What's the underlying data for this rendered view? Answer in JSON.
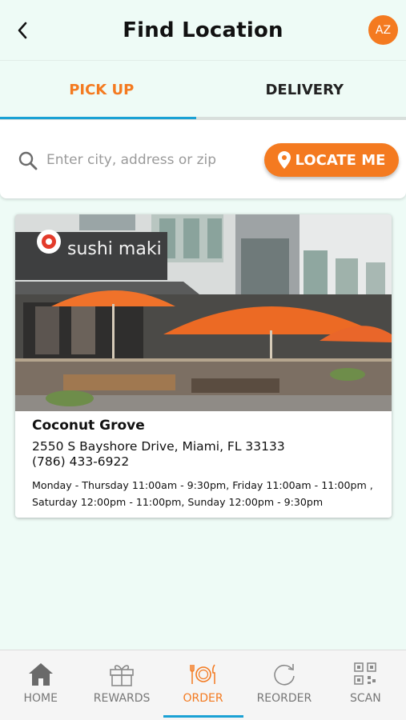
{
  "header": {
    "title": "Find Location",
    "avatar_initials": "AZ"
  },
  "tabs": [
    {
      "label": "PICK UP",
      "active": true
    },
    {
      "label": "DELIVERY",
      "active": false
    }
  ],
  "search": {
    "placeholder": "Enter city, address or zip",
    "value": "",
    "locate_label": "LOCATE ME"
  },
  "location": {
    "name": "Coconut Grove",
    "address": "2550 S Bayshore Drive, Miami, FL 33133",
    "phone": "(786) 433-6922",
    "hours": "Monday - Thursday 11:00am - 9:30pm, Friday 11:00am - 11:00pm , Saturday 12:00pm - 11:00pm, Sunday 12:00pm - 9:30pm",
    "sign_text": "sushi maki"
  },
  "bottom_nav": [
    {
      "label": "HOME",
      "icon": "home-icon",
      "active": false
    },
    {
      "label": "REWARDS",
      "icon": "gift-icon",
      "active": false
    },
    {
      "label": "ORDER",
      "icon": "utensils-icon",
      "active": true
    },
    {
      "label": "REORDER",
      "icon": "refresh-icon",
      "active": false
    },
    {
      "label": "SCAN",
      "icon": "qr-icon",
      "active": false
    }
  ],
  "colors": {
    "accent": "#f47a20",
    "tab_indicator": "#1aa1d4",
    "background": "#eefbf6"
  }
}
